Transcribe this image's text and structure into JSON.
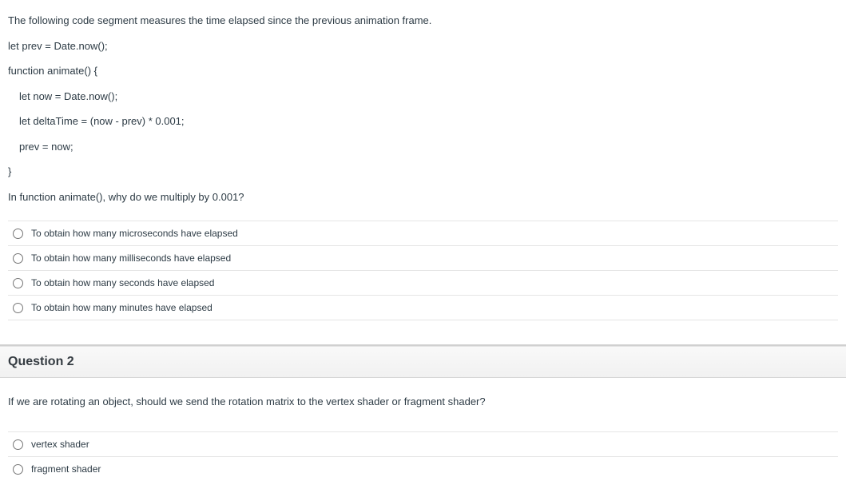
{
  "q1": {
    "prompt": {
      "intro": "The following code segment measures the time elapsed since the previous animation frame.",
      "line1": "let prev = Date.now();",
      "line2": "function animate() {",
      "line3": "let now = Date.now();",
      "line4": "let deltaTime = (now - prev) * 0.001;",
      "line5": "prev = now;",
      "line6": "}",
      "ask": "In function animate(), why do we multiply by 0.001?"
    },
    "options": [
      "To obtain how many microseconds have elapsed",
      "To obtain how many milliseconds have elapsed",
      "To obtain how many seconds have elapsed",
      "To obtain how many minutes have elapsed"
    ]
  },
  "q2": {
    "header": "Question 2",
    "prompt": "If we are rotating an object, should we send the rotation matrix to the vertex shader or fragment shader?",
    "options": [
      "vertex shader",
      "fragment shader"
    ]
  }
}
